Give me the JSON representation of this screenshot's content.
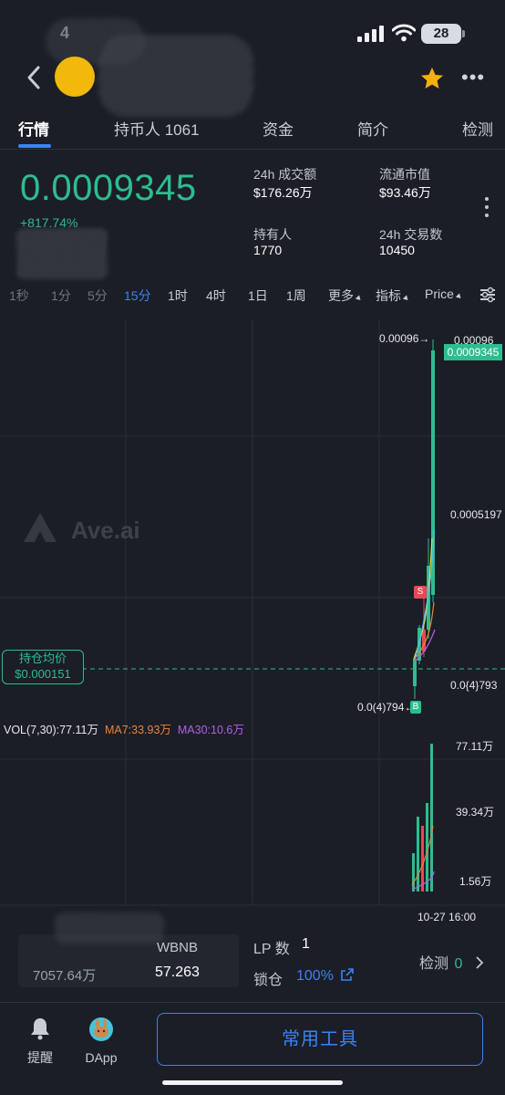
{
  "status_bar": {
    "time": "4",
    "battery": "28"
  },
  "tabs": [
    {
      "label": "行情"
    },
    {
      "label": "持币人 1061"
    },
    {
      "label": "资金"
    },
    {
      "label": "简介"
    },
    {
      "label": "检测"
    }
  ],
  "price_panel": {
    "price": "0.0009345",
    "change": "+817.74%",
    "stats": [
      {
        "label": "24h 成交额",
        "value": "$176.26万"
      },
      {
        "label": "流通市值",
        "value": "$93.46万"
      },
      {
        "label": "持有人",
        "value": "1770"
      },
      {
        "label": "24h 交易数",
        "value": "10450"
      }
    ]
  },
  "intervals": [
    {
      "label": "1秒"
    },
    {
      "label": "1分"
    },
    {
      "label": "5分"
    },
    {
      "label": "15分"
    },
    {
      "label": "1时"
    },
    {
      "label": "4时"
    },
    {
      "label": "1日"
    },
    {
      "label": "1周"
    },
    {
      "label": "更多"
    },
    {
      "label": "指标"
    },
    {
      "label": "Price"
    }
  ],
  "chart": {
    "watermark": "Ave.ai",
    "high_label": "0.00096→",
    "axis_top": "0.00096",
    "current_price": "0.0009345",
    "axis_mid": "0.0005197",
    "axis_low": "0.0{4}793",
    "low_label": "0.0(4)794←",
    "avg_tag_title": "持仓均价",
    "avg_tag_value": "$0.000151",
    "sell_marker": "S",
    "buy_marker": "B",
    "vol_legend": {
      "vol": "VOL(7,30):77.11万",
      "ma7": "MA7:33.93万",
      "ma30": "MA30:10.6万"
    },
    "vol_axis": [
      "77.11万",
      "39.34万",
      "1.56万"
    ],
    "time_label": "10-27 16:00",
    "colors": {
      "up": "#2dbd8f",
      "down": "#e84855",
      "ma7": "#e8843c",
      "ma30": "#b75ee8",
      "avg": "#2dbd8f"
    }
  },
  "lp_panel": {
    "amount": "7057.64万",
    "pair_name": "WBNB",
    "pair_amount": "57.263",
    "lp_label": "LP 数",
    "lp_count": "1",
    "lock_label": "锁仓",
    "lock_value": "100%",
    "check_label": "检测",
    "check_count": "0"
  },
  "bottom_bar": {
    "alert_label": "提醒",
    "dapp_label": "DApp",
    "tools_button": "常用工具"
  }
}
